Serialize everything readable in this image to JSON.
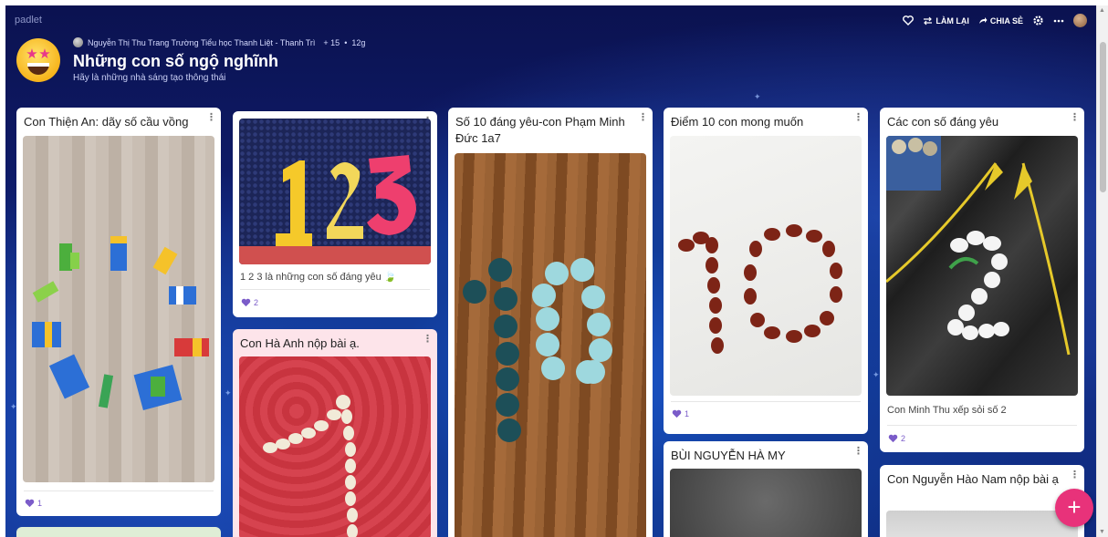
{
  "app": {
    "brand": "padlet"
  },
  "toolbar": {
    "remake_label": "LÀM LẠI",
    "share_label": "CHIA SẺ",
    "icons": [
      "heart-icon",
      "remake-icon",
      "share-icon",
      "gear-icon",
      "more-icon",
      "avatar"
    ]
  },
  "board": {
    "author": "Nguyễn Thị Thu Trang Trường Tiểu học Thanh Liệt - Thanh Trì",
    "plus": "+ 15",
    "separator": "•",
    "age": "12g",
    "title": "Những con số ngộ nghĩnh",
    "subtitle": "Hãy là những nhà sáng tạo thông thái"
  },
  "cards": [
    {
      "title": "Con Thiện An: dãy số cầu vồng",
      "likes": "1"
    },
    {
      "title": "",
      "caption": "1 2 3 là những con số đáng yêu 🍃",
      "likes": "2"
    },
    {
      "title": "Con Hà Anh nộp bài ạ."
    },
    {
      "title": "Số 10 đáng yêu-con Phạm Minh Đức 1a7"
    },
    {
      "title": "Điểm 10 con mong muốn",
      "likes": "1"
    },
    {
      "title": "BÙI NGUYỄN HÀ MY"
    },
    {
      "title": "Các con số đáng yêu",
      "caption": "Con Minh Thu xếp sỏi số 2",
      "likes": "2"
    },
    {
      "title": "Con Nguyễn Hào Nam nộp bài ạ"
    }
  ],
  "colors": {
    "accent": "#e8327a",
    "like": "#7b5cc9",
    "background": "#0e1a66",
    "pink_card": "#fde4ea"
  },
  "fab": {
    "label": "+"
  }
}
